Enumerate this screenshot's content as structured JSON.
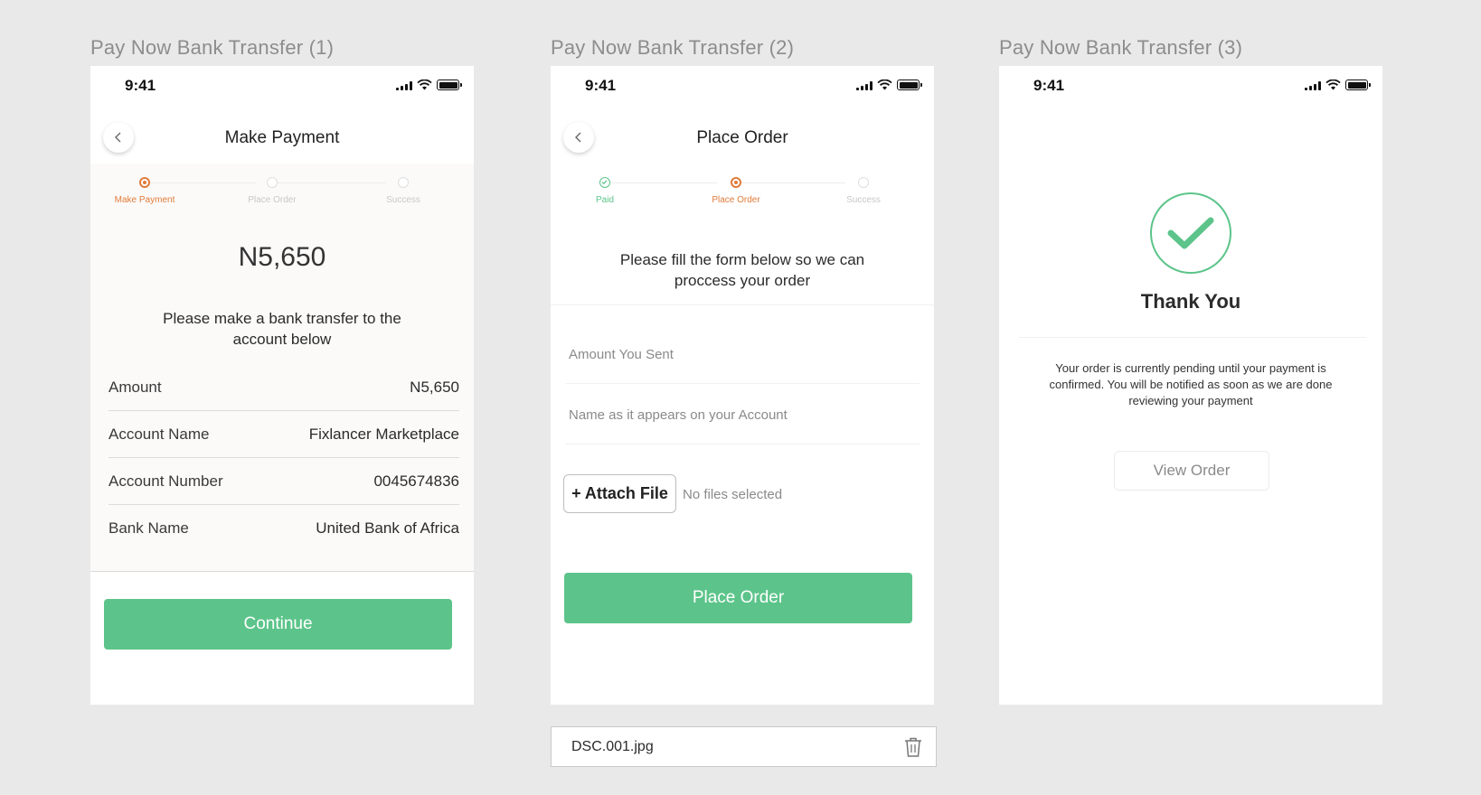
{
  "status_time": "9:41",
  "colors": {
    "accent_green": "#5cc48a",
    "accent_orange": "#e07b39",
    "background": "#e9e9e9"
  },
  "screen1": {
    "frame_title": "Pay Now Bank Transfer (1)",
    "nav_title": "Make Payment",
    "steps": [
      {
        "label": "Make Payment",
        "state": "active"
      },
      {
        "label": "Place Order",
        "state": "inactive"
      },
      {
        "label": "Success",
        "state": "inactive"
      }
    ],
    "amount": "N5,650",
    "message": "Please make a bank transfer to the account below",
    "details": [
      {
        "key": "Amount",
        "value": "N5,650"
      },
      {
        "key": "Account Name",
        "value": "Fixlancer Marketplace"
      },
      {
        "key": "Account Number",
        "value": "0045674836"
      },
      {
        "key": "Bank Name",
        "value": "United Bank of Africa"
      }
    ],
    "continue_label": "Continue"
  },
  "screen2": {
    "frame_title": "Pay Now Bank Transfer (2)",
    "nav_title": "Place Order",
    "steps": [
      {
        "label": "Paid",
        "state": "done"
      },
      {
        "label": "Place Order",
        "state": "active"
      },
      {
        "label": "Success",
        "state": "inactive"
      }
    ],
    "message": "Please fill the form below so we can proccess your order",
    "amount_placeholder": "Amount You Sent",
    "name_placeholder": "Name as it appears on your Account",
    "attach_label": "+ Attach File",
    "no_files_text": "No files selected",
    "place_order_label": "Place Order"
  },
  "screen3": {
    "frame_title": "Pay Now Bank Transfer (3)",
    "heading": "Thank You",
    "message": "Your order is currently pending until your payment is confirmed. You will be notified as soon as we are done reviewing your payment",
    "view_order_label": "View Order"
  },
  "file_bar": {
    "filename": "DSC.001.jpg"
  }
}
